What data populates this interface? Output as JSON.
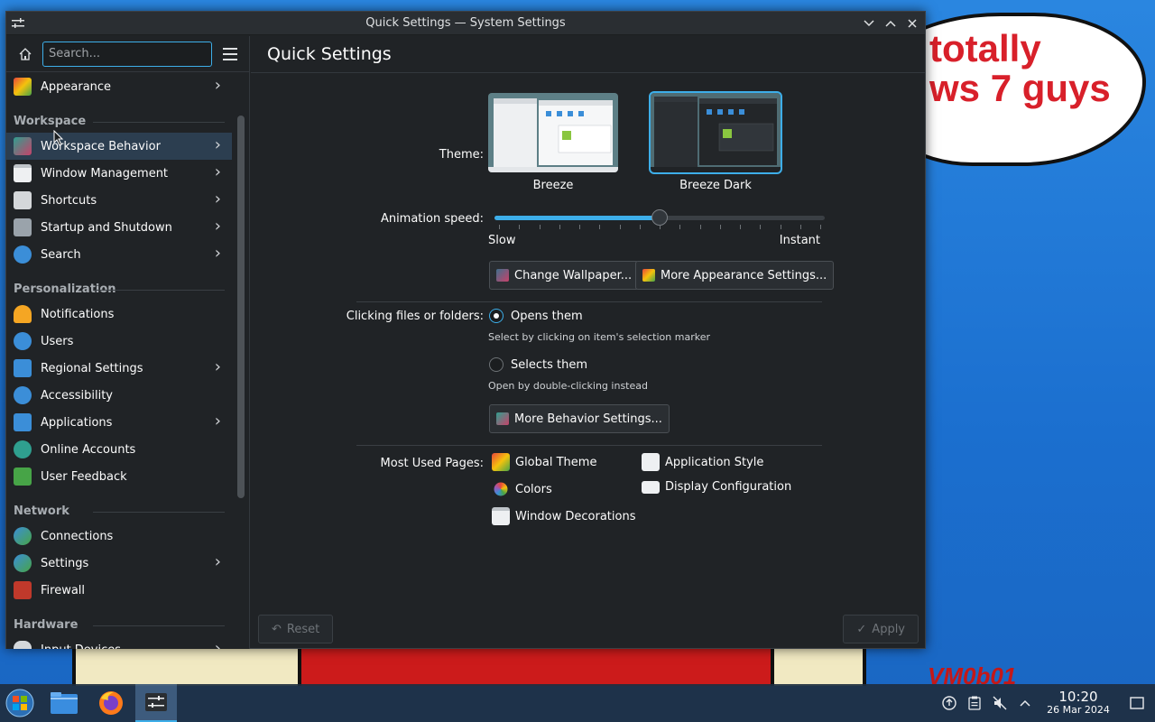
{
  "window": {
    "title": "Quick Settings — System Settings",
    "controls": [
      "minimize",
      "maximize",
      "close"
    ]
  },
  "sidebar": {
    "search_placeholder": "Search...",
    "items": [
      {
        "type": "item",
        "label": "Appearance",
        "icon": "appearance-icon",
        "chevron": true
      },
      {
        "type": "header",
        "label": "Workspace"
      },
      {
        "type": "item",
        "label": "Workspace Behavior",
        "icon": "workspace-behavior-icon",
        "chevron": true,
        "selected": true
      },
      {
        "type": "item",
        "label": "Window Management",
        "icon": "window-management-icon",
        "chevron": true
      },
      {
        "type": "item",
        "label": "Shortcuts",
        "icon": "keyboard-icon",
        "chevron": true
      },
      {
        "type": "item",
        "label": "Startup and Shutdown",
        "icon": "startup-icon",
        "chevron": true
      },
      {
        "type": "item",
        "label": "Search",
        "icon": "search-icon",
        "chevron": true
      },
      {
        "type": "header",
        "label": "Personalization"
      },
      {
        "type": "item",
        "label": "Notifications",
        "icon": "bell-icon",
        "chevron": false
      },
      {
        "type": "item",
        "label": "Users",
        "icon": "users-icon",
        "chevron": false
      },
      {
        "type": "item",
        "label": "Regional Settings",
        "icon": "regional-icon",
        "chevron": true
      },
      {
        "type": "item",
        "label": "Accessibility",
        "icon": "accessibility-icon",
        "chevron": false
      },
      {
        "type": "item",
        "label": "Applications",
        "icon": "applications-icon",
        "chevron": true
      },
      {
        "type": "item",
        "label": "Online Accounts",
        "icon": "online-accounts-icon",
        "chevron": false
      },
      {
        "type": "item",
        "label": "User Feedback",
        "icon": "feedback-icon",
        "chevron": false
      },
      {
        "type": "header",
        "label": "Network"
      },
      {
        "type": "item",
        "label": "Connections",
        "icon": "globe-icon",
        "chevron": false
      },
      {
        "type": "item",
        "label": "Settings",
        "icon": "network-settings-icon",
        "chevron": true
      },
      {
        "type": "item",
        "label": "Firewall",
        "icon": "firewall-icon",
        "chevron": false
      },
      {
        "type": "header",
        "label": "Hardware"
      },
      {
        "type": "item",
        "label": "Input Devices",
        "icon": "input-devices-icon",
        "chevron": true
      }
    ]
  },
  "main": {
    "title": "Quick Settings",
    "theme_label": "Theme:",
    "themes": [
      {
        "name": "Breeze",
        "selected": false
      },
      {
        "name": "Breeze Dark",
        "selected": true
      }
    ],
    "animation_label": "Animation speed:",
    "animation_value_fraction": 0.5,
    "slider_min_label": "Slow",
    "slider_max_label": "Instant",
    "change_wallpaper": "Change Wallpaper...",
    "more_appearance": "More Appearance Settings...",
    "clicking_label": "Clicking files or folders:",
    "opens_them": "Opens them",
    "opens_hint": "Select by clicking on item's selection marker",
    "selects_them": "Selects them",
    "selects_hint": "Open by double-clicking instead",
    "more_behavior": "More Behavior Settings...",
    "most_used_label": "Most Used Pages:",
    "most_used": [
      {
        "label": "Global Theme",
        "icon": "global-theme-icon"
      },
      {
        "label": "Application Style",
        "icon": "application-style-icon"
      },
      {
        "label": "Colors",
        "icon": "colors-icon"
      },
      {
        "label": "Display Configuration",
        "icon": "display-icon"
      },
      {
        "label": "Window Decorations",
        "icon": "window-decorations-icon"
      }
    ],
    "reset": "Reset",
    "apply": "Apply"
  },
  "desktop": {
    "bubble_text": "totally\nws 7 guys",
    "watermark": "VM0b01"
  },
  "taskbar": {
    "apps": [
      "start-menu-icon",
      "file-manager-icon",
      "firefox-icon",
      "system-settings-icon"
    ],
    "time": "10:20",
    "date": "26 Mar 2024"
  },
  "colors": {
    "accent": "#3daee9",
    "window_bg": "#202326",
    "selected_row": "#2c3e50"
  }
}
